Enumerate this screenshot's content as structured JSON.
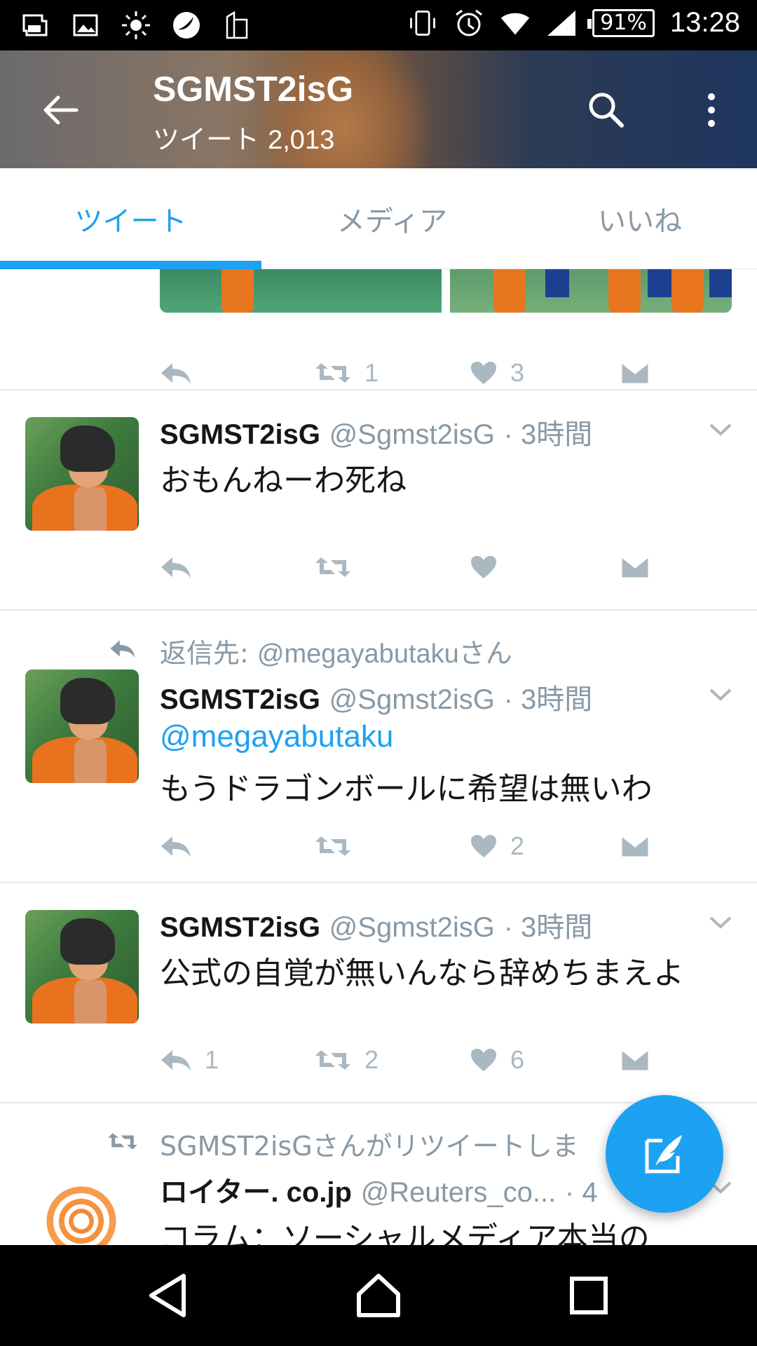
{
  "status_bar": {
    "battery": "91%",
    "time": "13:28",
    "icons_left": [
      "notification-photo-icon",
      "gallery-icon",
      "brightness-icon",
      "app-icon",
      "sim-icon"
    ],
    "icons_right": [
      "vibrate-icon",
      "alarm-icon",
      "wifi-icon",
      "signal-icon",
      "battery-icon"
    ]
  },
  "header": {
    "title": "SGMST2isG",
    "tweets_label": "ツイート",
    "tweets_count": "2,013"
  },
  "tabs": [
    {
      "label": "ツイート",
      "active": true
    },
    {
      "label": "メディア",
      "active": false
    },
    {
      "label": "いいね",
      "active": false
    }
  ],
  "top_partial_tweet": {
    "retweets": "1",
    "likes": "3"
  },
  "tweets": [
    {
      "name": "SGMST2isG",
      "handle": "@Sgmst2isG",
      "time": "· 3時間",
      "text": "おもんねーわ死ね",
      "replies": "",
      "retweets": "",
      "likes": ""
    },
    {
      "context_label": "返信先",
      "context_sep": ":",
      "context_mention": "@megayabutaku",
      "context_suffix": "さん",
      "name": "SGMST2isG",
      "handle": "@Sgmst2isG",
      "time": "· 3時間",
      "mention": "@megayabutaku",
      "text": "もうドラゴンボールに希望は無いわ",
      "replies": "",
      "retweets": "",
      "likes": "2"
    },
    {
      "name": "SGMST2isG",
      "handle": "@Sgmst2isG",
      "time": "· 3時間",
      "text": "公式の自覚が無いんなら辞めちまえよ",
      "replies": "1",
      "retweets": "2",
      "likes": "6"
    },
    {
      "context_text": "SGMST2isGさんがリツイートしま",
      "name": "ロイター. co.jp",
      "handle": "@Reuters_co...",
      "time": "· 4",
      "text": "コラム：ソーシャルメディア本当の"
    }
  ],
  "colors": {
    "accent": "#1da1f2",
    "muted": "#8899a6",
    "icon_gray": "#aab8c2"
  }
}
